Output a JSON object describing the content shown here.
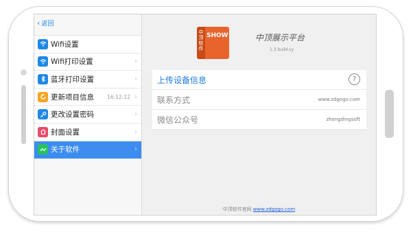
{
  "sidebar": {
    "back_label": "返回",
    "items": [
      {
        "label": "Wifi设置",
        "icon": "wifi-icon",
        "color": "#1e88e5",
        "detail": "",
        "has_chevron": false
      },
      {
        "label": "Wifi打印设置",
        "icon": "wifi-icon",
        "color": "#1e88e5",
        "detail": "",
        "has_chevron": true
      },
      {
        "label": "蓝牙打印设置",
        "icon": "bluetooth-icon",
        "color": "#1e88e5",
        "detail": "",
        "has_chevron": true
      },
      {
        "label": "更新项目信息",
        "icon": "refresh-icon",
        "color": "#f5a623",
        "detail": "16-12-12",
        "has_chevron": true
      },
      {
        "label": "更改设置密码",
        "icon": "key-icon",
        "color": "#1e88e5",
        "detail": "",
        "has_chevron": true
      },
      {
        "label": "封面设置",
        "icon": "home-icon",
        "color": "#e94b6a",
        "detail": "",
        "has_chevron": true
      },
      {
        "label": "关于软件",
        "icon": "app-icon",
        "color": "#27c25f",
        "detail": "",
        "has_chevron": true,
        "active": true
      }
    ]
  },
  "about": {
    "logo_vertical_text": "中顶软件",
    "logo_badge": "SHOW",
    "app_name": "中顶展示平台",
    "version": "1.3 build-cy"
  },
  "info": {
    "upload_label": "上传设备信息",
    "help_icon": "?",
    "rows": [
      {
        "label": "联系方式",
        "value": "www.zdgogo.com"
      },
      {
        "label": "微信公众号",
        "value": "zhongdingsoft"
      }
    ]
  },
  "footer": {
    "label": "中顶软件官网",
    "link": "www.zdgogo.com"
  }
}
